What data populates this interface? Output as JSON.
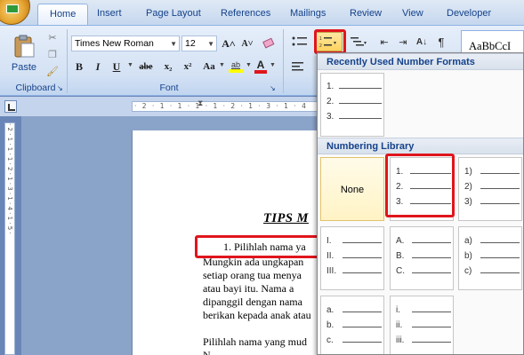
{
  "tabs": [
    {
      "label": "Home"
    },
    {
      "label": "Insert"
    },
    {
      "label": "Page Layout"
    },
    {
      "label": "References"
    },
    {
      "label": "Mailings"
    },
    {
      "label": "Review"
    },
    {
      "label": "View"
    },
    {
      "label": "Developer"
    }
  ],
  "clipboard": {
    "paste_label": "Paste",
    "group_label": "Clipboard"
  },
  "font": {
    "name": "Times New Roman",
    "size": "12",
    "group_label": "Font",
    "bold": "B",
    "italic": "I",
    "underline": "U",
    "strike": "abe",
    "subscript": "x₂",
    "superscript": "x²",
    "change_case": "Aa",
    "grow": "A˄",
    "shrink": "A˅",
    "highlight": "ab",
    "font_color": "A"
  },
  "styles": {
    "preview": "AaBbCcI"
  },
  "ruler": {
    "horizontal": "· 2 · 1 · 1 · 1 · 1 · 2 · 1 · 3 · 1 · 4",
    "vertical": "· 2 · 1 · 1 · 1 · 2 · 1 · 3 · 1 · 4 · 1 · 5 ·"
  },
  "document": {
    "title": "TIPS M",
    "list_item": "1.   Pilihlah nama ya",
    "paragraph1": [
      "Mungkin ada ungkapan",
      "setiap orang tua menya",
      "atau bayi itu. Nama a",
      "dipanggil dengan nama",
      "berikan kepada anak atau"
    ],
    "paragraph2": "Pilihlah nama yang mud",
    "paragraph2b": "N"
  },
  "gallery": {
    "recent_header": "Recently Used Number Formats",
    "library_header": "Numbering Library",
    "none_label": "None",
    "recent": [
      "1.",
      "2.",
      "3."
    ],
    "formats": [
      [
        "1.",
        "2.",
        "3."
      ],
      [
        "1)",
        "2)",
        "3)"
      ],
      [
        "I.",
        "II.",
        "III."
      ],
      [
        "A.",
        "B.",
        "C."
      ],
      [
        "a)",
        "b)",
        "c)"
      ],
      [
        "a.",
        "b.",
        "c."
      ],
      [
        "i.",
        "ii.",
        "iii."
      ]
    ]
  },
  "colors": {
    "highlight_box": "#e0151c",
    "ribbon_text": "#15428b"
  }
}
